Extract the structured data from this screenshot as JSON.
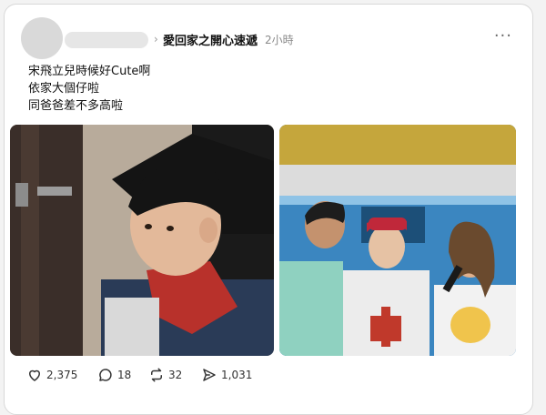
{
  "post": {
    "community": "愛回家之開心速遞",
    "time": "2小時",
    "more_label": "···",
    "lines": [
      "宋飛立兒時候好Cute啊",
      "依家大個仔啦",
      "同爸爸差不多高啦"
    ]
  },
  "actions": {
    "likes": "2,375",
    "comments": "18",
    "reposts": "32",
    "shares": "1,031"
  },
  "colors": {
    "background": "#f3f3f3",
    "card": "#ffffff",
    "muted_text": "#8a8a8a"
  },
  "icons": [
    "chevron-right-icon",
    "more-icon",
    "heart-icon",
    "comment-icon",
    "repost-icon",
    "share-icon"
  ]
}
